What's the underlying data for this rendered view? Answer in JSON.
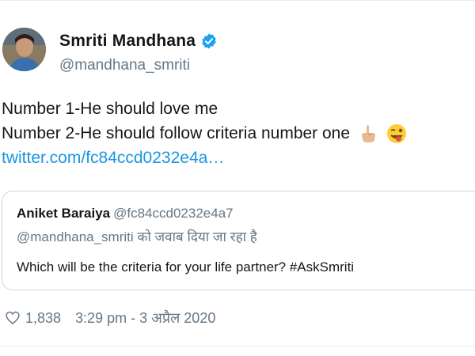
{
  "author": {
    "name": "Smriti Mandhana",
    "handle": "@mandhana_smriti"
  },
  "tweet": {
    "line1": "Number 1-He should love me",
    "line2": "Number 2-He should follow criteria number one",
    "link": "twitter.com/fc84ccd0232e4a…",
    "emojis": [
      "pointing-up-icon",
      "winking-tongue-face-icon"
    ]
  },
  "quoted": {
    "name": "Aniket Baraiya",
    "handle": "@fc84ccd0232e4a7",
    "reply_mention": "@mandhana_smriti",
    "reply_text": " को जवाब दिया जा रहा है",
    "text": "Which will be the criteria for your life partner? #AskSmriti"
  },
  "meta": {
    "likes": "1,838",
    "timestamp": "3:29 pm - 3 अप्रैल 2020"
  },
  "colors": {
    "link": "#1b95e0",
    "secondary": "#657786",
    "border": "#ccd6dd"
  }
}
